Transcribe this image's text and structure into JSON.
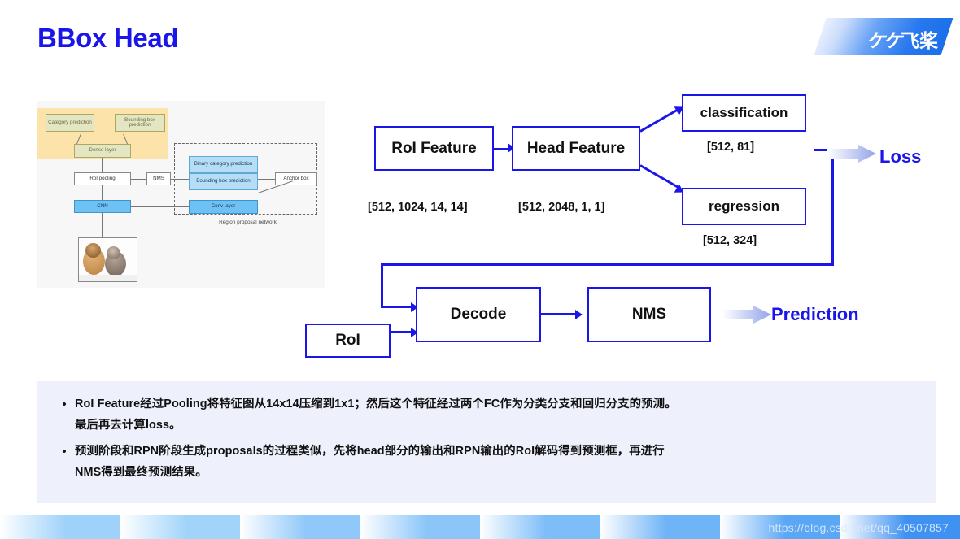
{
  "header": {
    "title": "BBox Head",
    "logo_text": "飞桨",
    "logo_mark": "paddlepaddle-logo",
    "accent_color": "#1a15e8",
    "logo_gradient_from": "#eaf1fd",
    "logo_gradient_to": "#1a6fe8"
  },
  "reference_figure": {
    "name": "faster-rcnn-architecture-figure",
    "highlight_color": "#fbdf9b",
    "caption": "Region proposal network",
    "boxes": [
      {
        "label": "Category prediction",
        "style": "olive"
      },
      {
        "label": "Bounding box prediction",
        "style": "olive"
      },
      {
        "label": "Dense layer",
        "style": "olive"
      },
      {
        "label": "RoI pooling",
        "style": "white"
      },
      {
        "label": "CNN",
        "style": "blue"
      },
      {
        "label": "NMS",
        "style": "white"
      },
      {
        "label": "Binary category prediction",
        "style": "lblue"
      },
      {
        "label": "Bounding box prediction",
        "style": "lblue"
      },
      {
        "label": "Anchor box",
        "style": "white"
      },
      {
        "label": "Conv layer",
        "style": "blue"
      }
    ],
    "photo_alt": "dog-and-cat-photo"
  },
  "flow": {
    "boxes": {
      "roi_feature": "RoI Feature",
      "head_feature": "Head Feature",
      "classification": "classification",
      "regression": "regression",
      "decode": "Decode",
      "nms": "NMS",
      "roi": "RoI"
    },
    "shapes": {
      "roi_feature": "[512, 1024, 14, 14]",
      "head_feature": "[512, 2048, 1, 1]",
      "classification": "[512, 81]",
      "regression": "[512, 324]"
    },
    "outputs": {
      "loss": "Loss",
      "prediction": "Prediction"
    },
    "line_color": "#1a15e8"
  },
  "notes": {
    "bullet": "•",
    "items": [
      {
        "line1": "RoI Feature经过Pooling将特征图从14x14压缩到1x1；然后这个特征经过两个FC作为分类分支和回归分支的预测。",
        "line2": "最后再去计算loss。"
      },
      {
        "line1": "预测阶段和RPN阶段生成proposals的过程类似，先将head部分的输出和RPN输出的RoI解码得到预测框，再进行",
        "line2": "NMS得到最终预测结果。"
      }
    ]
  },
  "footer": {
    "watermark": "https://blog.csdn.net/qq_40507857",
    "segment_colors": [
      "#9ed2fa",
      "#a2d4fa",
      "#8fc8f9",
      "#8cc6f9",
      "#7dbdf8",
      "#6fb4f7",
      "#5aa7f5",
      "#3f92f2"
    ]
  }
}
